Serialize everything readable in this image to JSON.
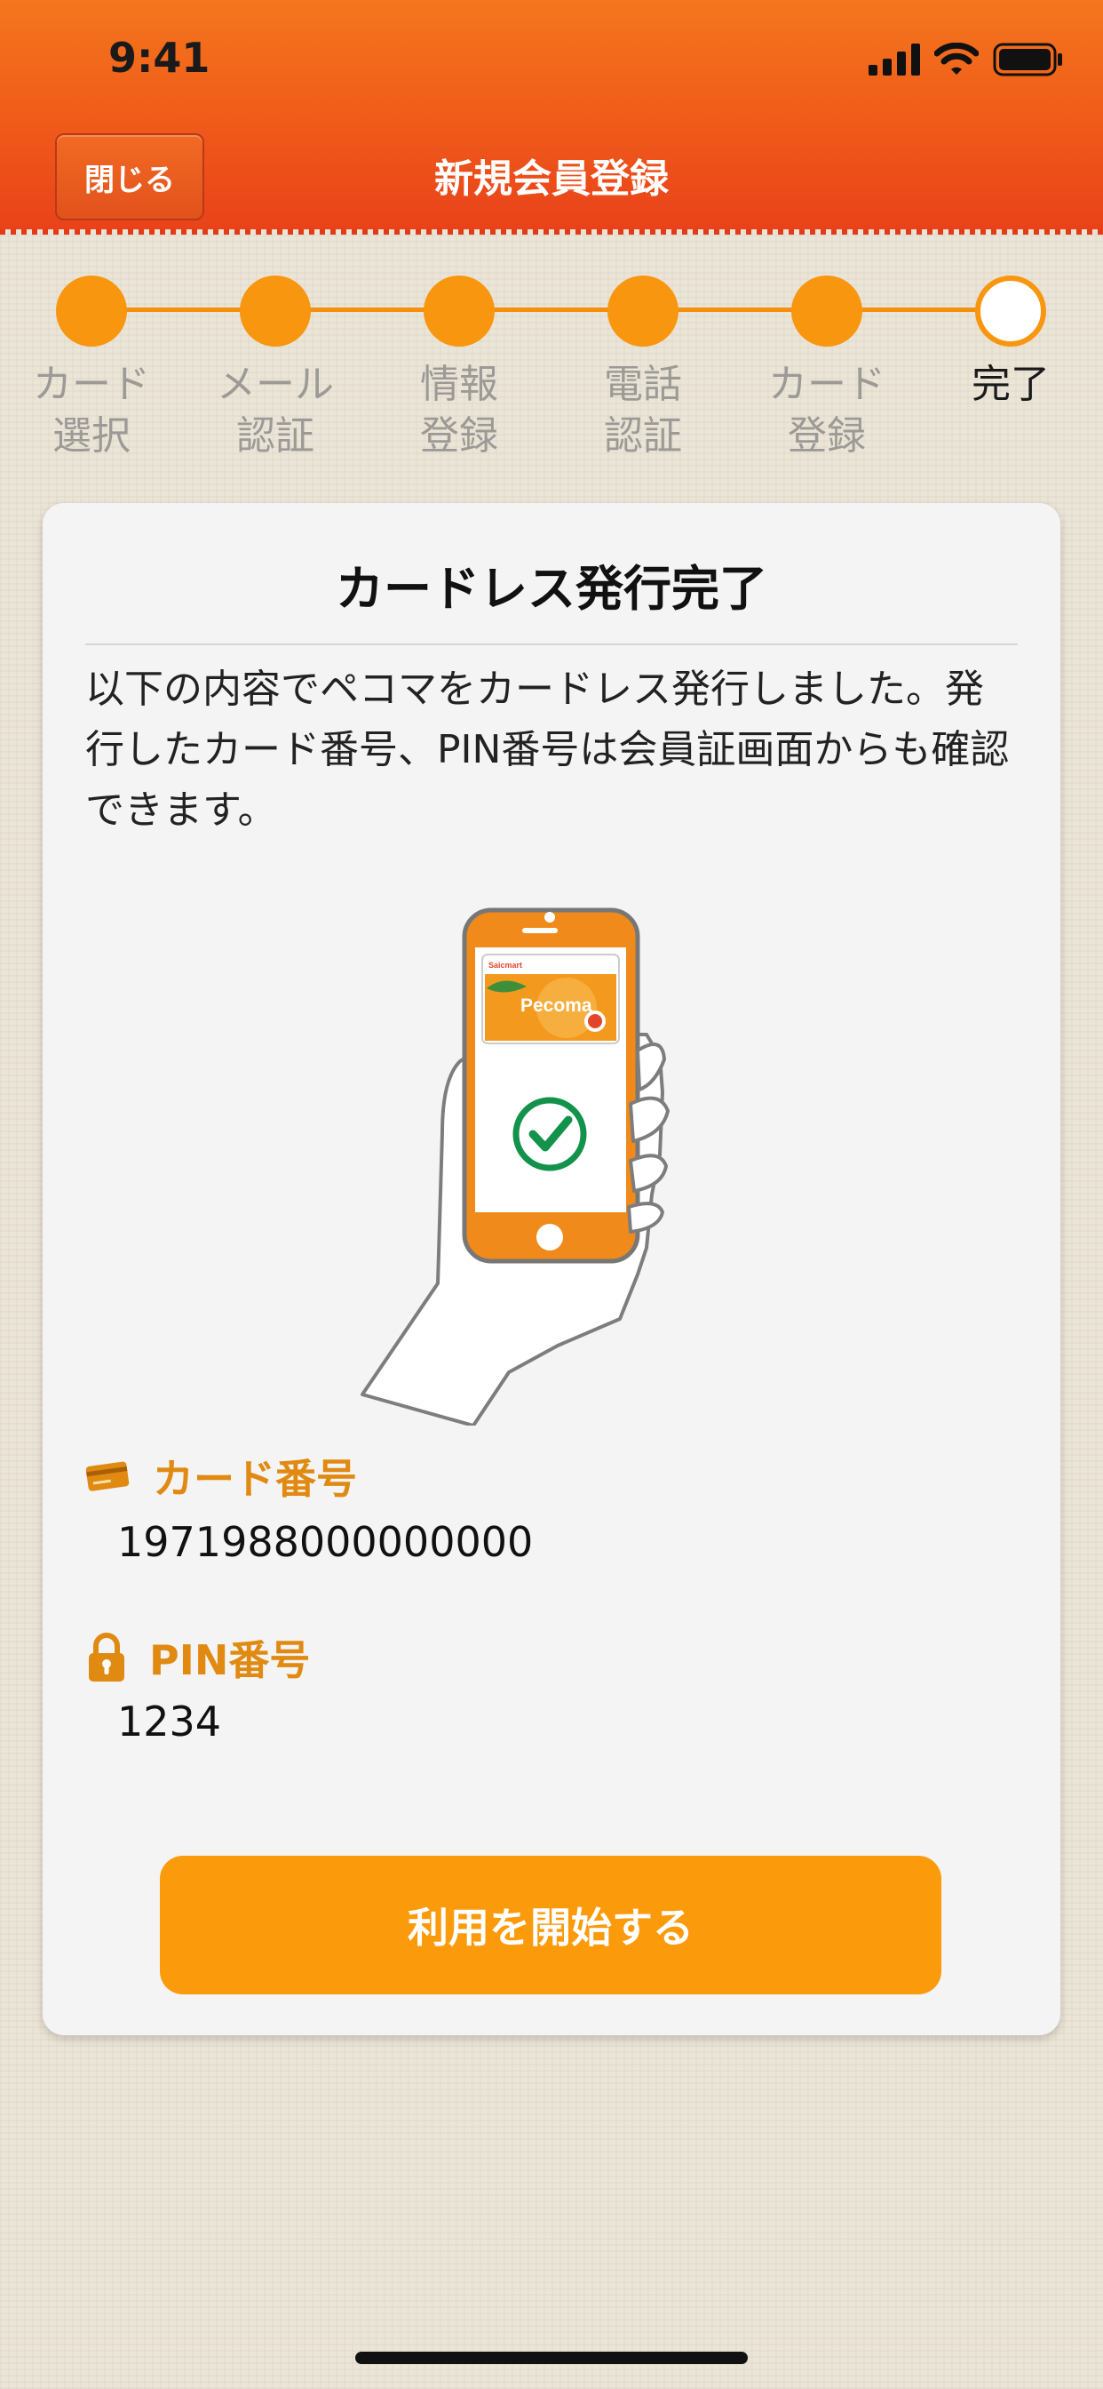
{
  "status_bar": {
    "time": "9:41"
  },
  "nav": {
    "close_label": "閉じる",
    "title": "新規会員登録"
  },
  "stepper": {
    "steps": [
      {
        "label": "カード\n選択",
        "done": true
      },
      {
        "label": "メール\n認証",
        "done": true
      },
      {
        "label": "情報\n登録",
        "done": true
      },
      {
        "label": "電話\n認証",
        "done": true
      },
      {
        "label": "カード\n登録",
        "done": true
      },
      {
        "label": "完了",
        "current": true
      }
    ]
  },
  "card": {
    "title": "カードレス発行完了",
    "description": "以下の内容でペコマをカードレス発行しました。発行したカード番号、PIN番号は会員証画面からも確認できます。",
    "phone_card_brand": "Saicmart",
    "phone_card_name": "Pecoma",
    "card_number_label": "カード番号",
    "card_number_value": "1971988000000000",
    "pin_label": "PIN番号",
    "pin_value": "1234",
    "start_button": "利用を開始する"
  },
  "colors": {
    "header": "#ef5a1a",
    "accent": "#f8960f",
    "label_accent": "#e08a12"
  }
}
